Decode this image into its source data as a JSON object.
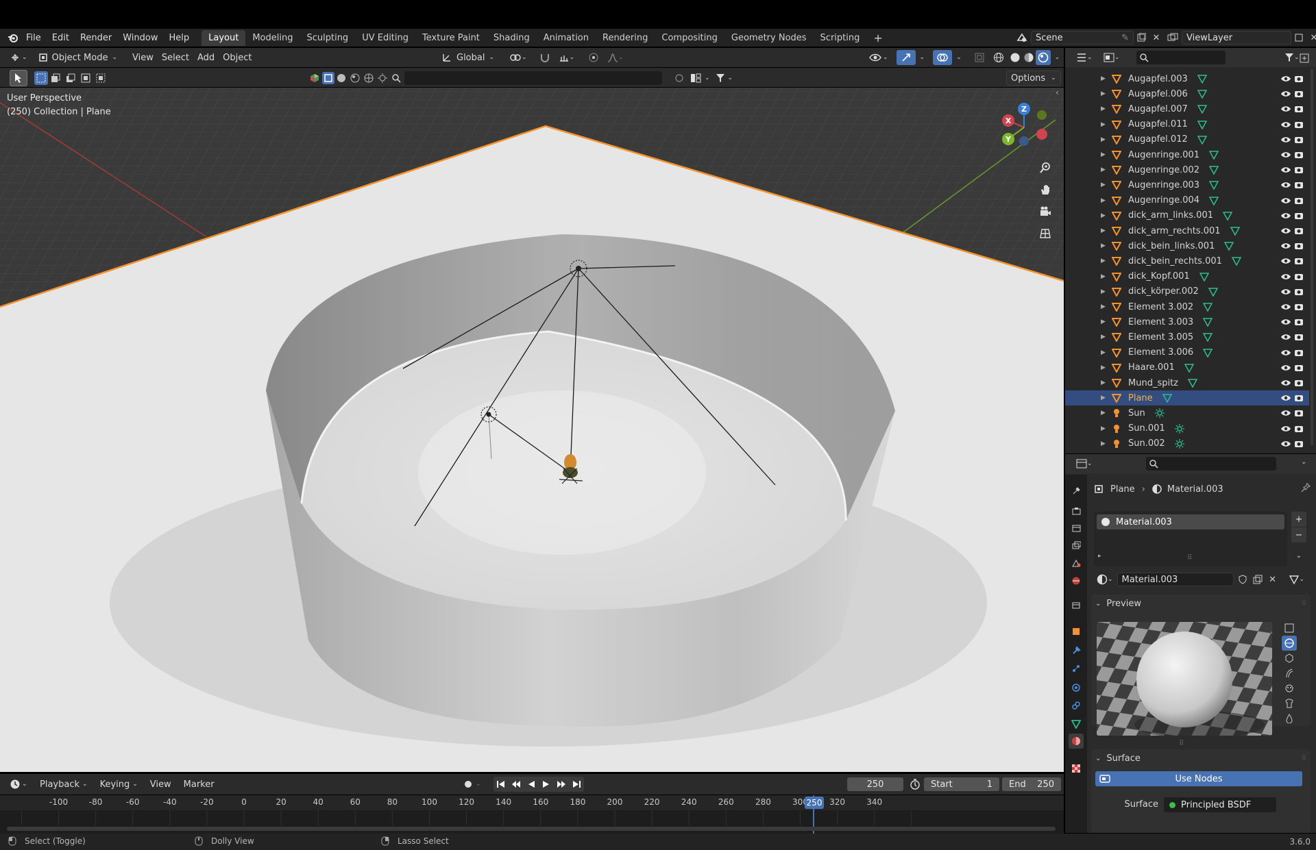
{
  "menubar": {
    "items": [
      "File",
      "Edit",
      "Render",
      "Window",
      "Help"
    ],
    "tabs": [
      "Layout",
      "Modeling",
      "Sculpting",
      "UV Editing",
      "Texture Paint",
      "Shading",
      "Animation",
      "Rendering",
      "Compositing",
      "Geometry Nodes",
      "Scripting"
    ],
    "active_tab": "Layout",
    "add_tab": "+",
    "scene": "Scene",
    "view_layer": "ViewLayer"
  },
  "viewport_header": {
    "mode": "Object Mode",
    "menus": [
      "View",
      "Select",
      "Add",
      "Object"
    ],
    "orientation": "Global",
    "options": "Options"
  },
  "viewport": {
    "perspective": "User Perspective",
    "collection": "(250) Collection | Plane",
    "axes": {
      "x": "X",
      "y": "Y",
      "z": "Z"
    }
  },
  "outliner": {
    "items": [
      {
        "name": "Augapfel.003",
        "type": "mesh"
      },
      {
        "name": "Augapfel.006",
        "type": "mesh"
      },
      {
        "name": "Augapfel.007",
        "type": "mesh"
      },
      {
        "name": "Augapfel.011",
        "type": "mesh"
      },
      {
        "name": "Augapfel.012",
        "type": "mesh"
      },
      {
        "name": "Augenringe.001",
        "type": "mesh"
      },
      {
        "name": "Augenringe.002",
        "type": "mesh"
      },
      {
        "name": "Augenringe.003",
        "type": "mesh"
      },
      {
        "name": "Augenringe.004",
        "type": "mesh"
      },
      {
        "name": "dick_arm_links.001",
        "type": "mesh"
      },
      {
        "name": "dick_arm_rechts.001",
        "type": "mesh"
      },
      {
        "name": "dick_bein_links.001",
        "type": "mesh"
      },
      {
        "name": "dick_bein_rechts.001",
        "type": "mesh"
      },
      {
        "name": "dick_Kopf.001",
        "type": "mesh"
      },
      {
        "name": "dick_körper.002",
        "type": "mesh"
      },
      {
        "name": "Element 3.002",
        "type": "mesh"
      },
      {
        "name": "Element 3.003",
        "type": "mesh"
      },
      {
        "name": "Element 3.005",
        "type": "mesh"
      },
      {
        "name": "Element 3.006",
        "type": "mesh"
      },
      {
        "name": "Haare.001",
        "type": "mesh"
      },
      {
        "name": "Mund_spitz",
        "type": "mesh"
      },
      {
        "name": "Plane",
        "type": "mesh",
        "selected": true
      },
      {
        "name": "Sun",
        "type": "light"
      },
      {
        "name": "Sun.001",
        "type": "light"
      },
      {
        "name": "Sun.002",
        "type": "light"
      }
    ]
  },
  "properties": {
    "breadcrumb_object": "Plane",
    "breadcrumb_material": "Material.003",
    "slot": "Material.003",
    "material_name": "Material.003",
    "preview_label": "Preview",
    "surface_label": "Surface",
    "use_nodes": "Use Nodes",
    "surface_field_label": "Surface",
    "surface_value": "Principled BSDF"
  },
  "timeline": {
    "menus": [
      "Playback",
      "Keying",
      "View",
      "Marker"
    ],
    "current_frame": "250",
    "start_label": "Start",
    "start_value": "1",
    "end_label": "End",
    "end_value": "250",
    "ruler": [
      "-100",
      "-80",
      "-60",
      "-40",
      "-20",
      "0",
      "20",
      "40",
      "60",
      "80",
      "100",
      "120",
      "140",
      "160",
      "180",
      "200",
      "220",
      "240",
      "250",
      "260",
      "280",
      "300",
      "320",
      "340"
    ]
  },
  "statusbar": {
    "hints": [
      "Select (Toggle)",
      "Dolly View",
      "Lasso Select"
    ],
    "version": "3.6.0"
  },
  "colors": {
    "accent": "#4772b3",
    "selection_row": "#334d80",
    "selected_text": "#ffaf29",
    "object_orange": "#f5922b",
    "mesh_data_green": "#2bbf8c",
    "light_yellow": "#f0c060"
  }
}
